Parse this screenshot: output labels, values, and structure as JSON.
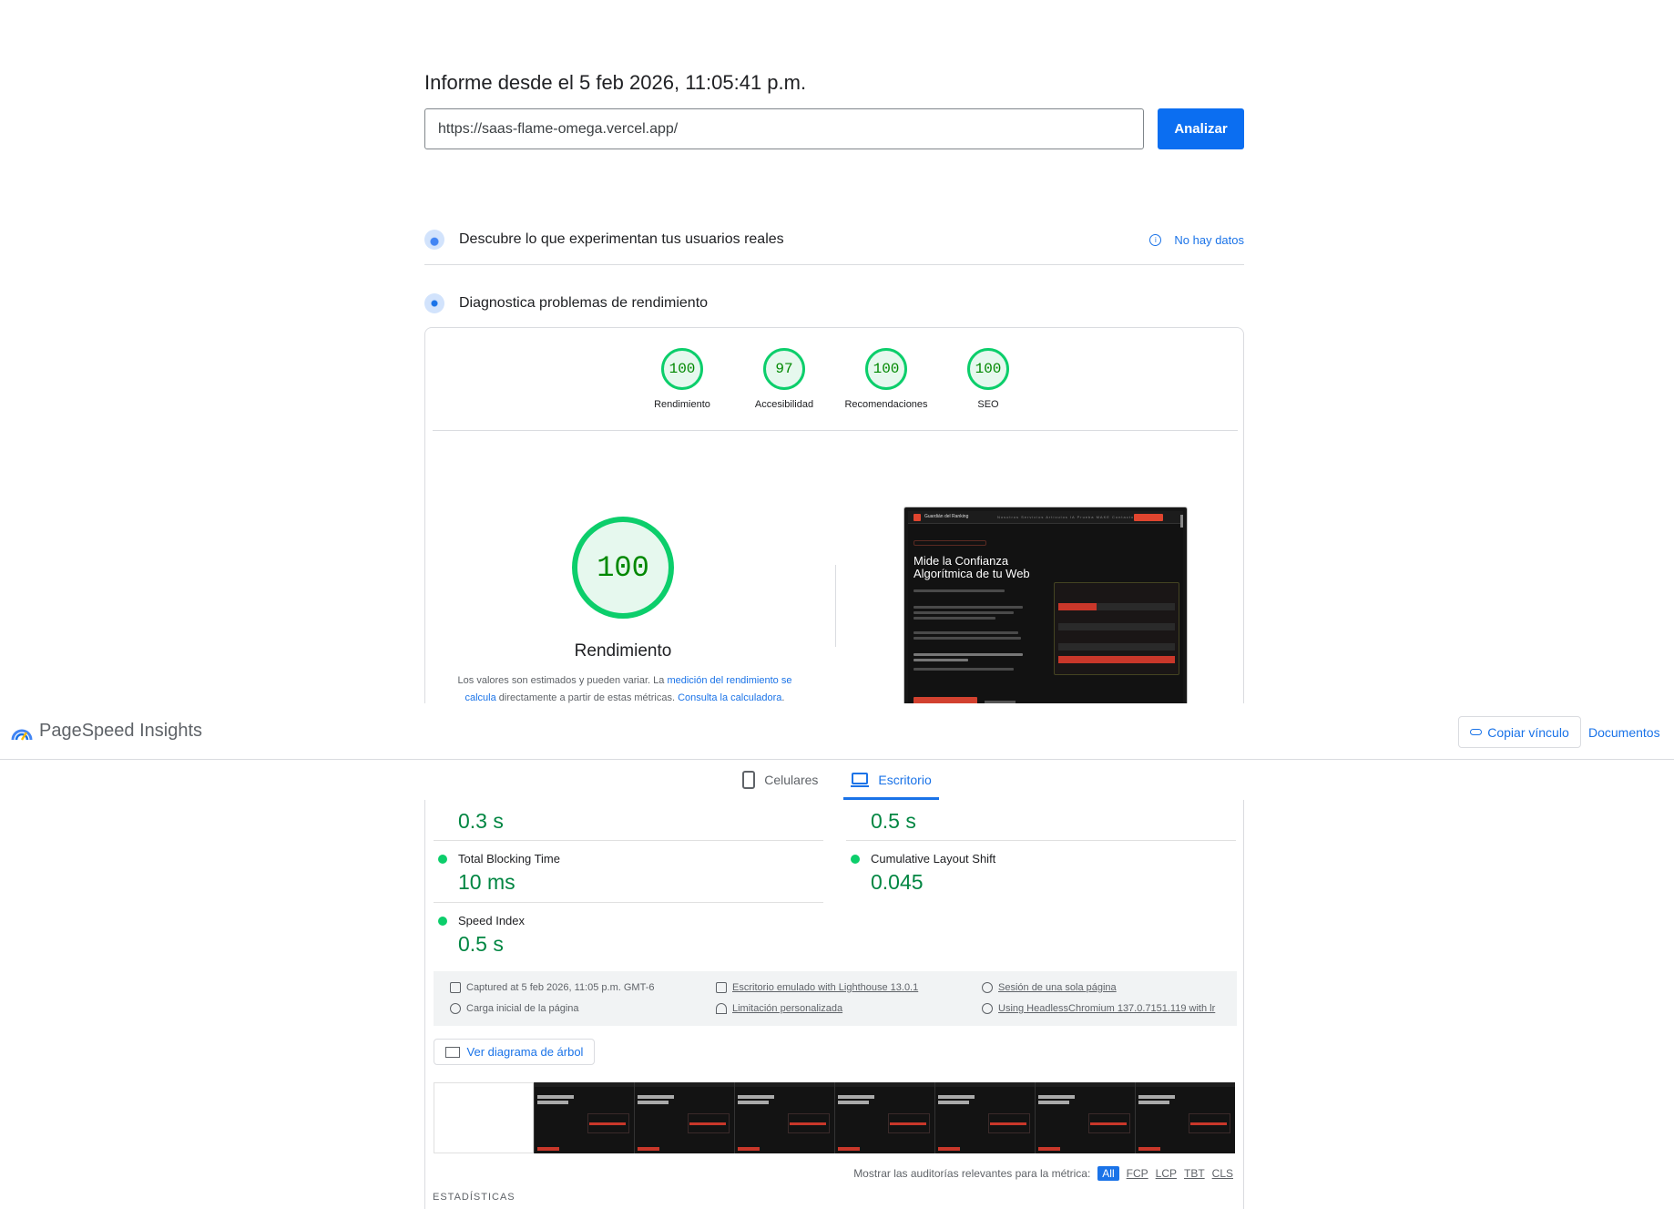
{
  "report": {
    "title": "Informe desde el 5 feb 2026, 11:05:41 p.m.",
    "url_value": "https://saas-flame-omega.vercel.app/",
    "analyze_label": "Analizar"
  },
  "sections": {
    "real_users_title": "Descubre lo que experimentan tus usuarios reales",
    "no_data_label": "No hay datos",
    "diagnose_title": "Diagnostica problemas de rendimiento"
  },
  "scores": [
    {
      "label": "Rendimiento",
      "value": "100"
    },
    {
      "label": "Accesibilidad",
      "value": "97"
    },
    {
      "label": "Recomendaciones",
      "value": "100"
    },
    {
      "label": "SEO",
      "value": "100"
    }
  ],
  "performance": {
    "score": "100",
    "label": "Rendimiento",
    "desc_1": "Los valores son estimados y pueden variar. La ",
    "desc_link_1": "medición del rendimiento se calcula",
    "desc_2": " directamente a partir de estas métricas. ",
    "desc_link_2": "Consulta la calculadora",
    "desc_3": "."
  },
  "screenshot": {
    "brand": "Guardián del Ranking",
    "links": "Nosotros  Servicios  Artículos  IA Prueba  MAKE  Contacto",
    "headline": "Mide la Confianza Algorítmica de tu Web"
  },
  "header": {
    "app_name": "PageSpeed Insights",
    "copy_label": "Copiar vínculo",
    "docs_label": "Documentos"
  },
  "tabs": [
    {
      "label": "Celulares",
      "active": false
    },
    {
      "label": "Escritorio",
      "active": true
    }
  ],
  "metrics": {
    "fcp_value": "0.3 s",
    "lcp_value": "0.5 s",
    "tbt_name": "Total Blocking Time",
    "tbt_value": "10 ms",
    "cls_name": "Cumulative Layout Shift",
    "cls_value": "0.045",
    "si_name": "Speed Index",
    "si_value": "0.5 s"
  },
  "run_info": {
    "captured": "Captured at 5 feb 2026, 11:05 p.m. GMT-6",
    "initial_load": "Carga inicial de la página",
    "emulated": "Escritorio emulado with Lighthouse 13.0.1",
    "throttling": "Limitación personalizada",
    "session": "Sesión de una sola página",
    "browser": "Using HeadlessChromium 137.0.7151.119 with lr"
  },
  "tree_label": "Ver diagrama de árbol",
  "filter": {
    "label": "Mostrar las auditorías relevantes para la métrica:",
    "options": [
      "All",
      "FCP",
      "LCP",
      "TBT",
      "CLS"
    ]
  },
  "stats_label": "ESTADÍSTICAS",
  "colors": {
    "accent": "#1a73e8",
    "button": "#0b6ef1",
    "pass": "#0cce6b",
    "pass_text": "#018642"
  }
}
